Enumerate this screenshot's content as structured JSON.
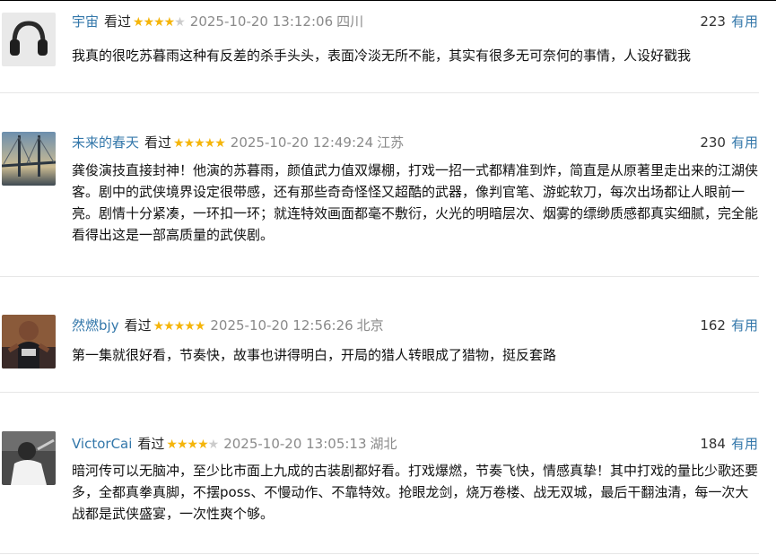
{
  "comments": [
    {
      "user": "宇宙",
      "status": "看过",
      "rating": 4,
      "time": "2025-10-20 13:12:06",
      "location": "四川",
      "votes": "223",
      "useful_label": "有用",
      "text": "我真的很吃苏暮雨这种有反差的杀手头头，表面冷淡无所不能，其实有很多无可奈何的事情，人设好戳我",
      "avatar": "headphones-avatar"
    },
    {
      "user": "未来的春天",
      "status": "看过",
      "rating": 5,
      "time": "2025-10-20 12:49:24",
      "location": "江苏",
      "votes": "230",
      "useful_label": "有用",
      "text": "龚俊演技直接封神！他演的苏暮雨，颜值武力值双爆棚，打戏一招一式都精准到炸，简直是从原著里走出来的江湖侠客。剧中的武侠境界设定很带感，还有那些奇奇怪怪又超酷的武器，像判官笔、游蛇软刀，每次出场都让人眼前一亮。剧情十分紧凑，一环扣一环；就连特效画面都毫不敷衍，火光的明暗层次、烟雾的缥缈质感都真实细腻，完全能看得出这是一部高质量的武侠剧。",
      "avatar": "bridge-avatar"
    },
    {
      "user": "然燃bjy",
      "status": "看过",
      "rating": 5,
      "time": "2025-10-20 12:56:26",
      "location": "北京",
      "votes": "162",
      "useful_label": "有用",
      "text": "第一集就很好看，节奏快，故事也讲得明白，开局的猎人转眼成了猎物，挺反套路",
      "avatar": "basketball-avatar"
    },
    {
      "user": "VictorCai",
      "status": "看过",
      "rating": 4,
      "time": "2025-10-20 13:05:13",
      "location": "湖北",
      "votes": "184",
      "useful_label": "有用",
      "text": "暗河传可以无脑冲，至少比市面上九成的古装剧都好看。打戏爆燃，节奏飞快，情感真挚！其中打戏的量比少歌还要多，全都真拳真脚，不摆poss、不慢动作、不靠特效。抢眼龙剑，烧万卷楼、战无双城，最后干翻浊清，每一次大战都是武侠盛宴，一次性爽个够。",
      "avatar": "player-avatar"
    }
  ],
  "colors": {
    "link": "#3377aa",
    "star": "#f5b50a",
    "star_off": "#cccccc",
    "meta": "#8a8a8a"
  }
}
